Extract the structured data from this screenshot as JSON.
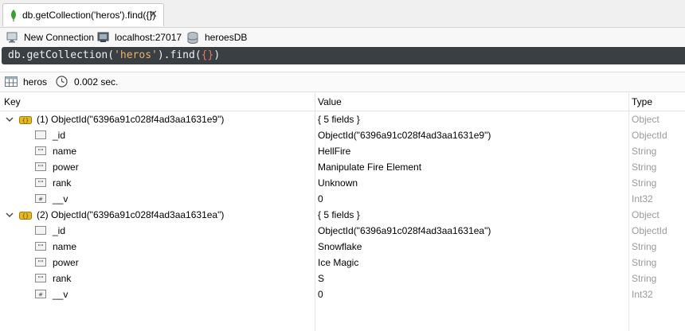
{
  "tab": {
    "label": "db.getCollection('heros').find({})"
  },
  "connection": {
    "new_connection": "New Connection",
    "host": "localhost:27017",
    "database": "heroesDB"
  },
  "query": {
    "prefix": "db.getCollection(",
    "collection": "'heros'",
    "middle": ").find(",
    "filter": "{}",
    "suffix": ")"
  },
  "result": {
    "collection": "heros",
    "time": "0.002 sec."
  },
  "columns": {
    "key": "Key",
    "value": "Value",
    "type": "Type"
  },
  "rows": [
    {
      "key": "(1) ObjectId(\"6396a91c028f4ad3aa1631e9\")",
      "value": "{ 5 fields }",
      "type": "Object"
    },
    {
      "key": "_id",
      "value": "ObjectId(\"6396a91c028f4ad3aa1631e9\")",
      "type": "ObjectId"
    },
    {
      "key": "name",
      "value": "HellFire",
      "type": "String"
    },
    {
      "key": "power",
      "value": "Manipulate Fire Element",
      "type": "String"
    },
    {
      "key": "rank",
      "value": "Unknown",
      "type": "String"
    },
    {
      "key": "__v",
      "value": "0",
      "type": "Int32"
    },
    {
      "key": "(2) ObjectId(\"6396a91c028f4ad3aa1631ea\")",
      "value": "{ 5 fields }",
      "type": "Object"
    },
    {
      "key": "_id",
      "value": "ObjectId(\"6396a91c028f4ad3aa1631ea\")",
      "type": "ObjectId"
    },
    {
      "key": "name",
      "value": "Snowflake",
      "type": "String"
    },
    {
      "key": "power",
      "value": "Ice Magic",
      "type": "String"
    },
    {
      "key": "rank",
      "value": "S",
      "type": "String"
    },
    {
      "key": "__v",
      "value": "0",
      "type": "Int32"
    }
  ],
  "colors": {
    "query_bg": "#3a3f44",
    "type_text": "#9a9a9a",
    "doc_icon": "#d4a017"
  }
}
